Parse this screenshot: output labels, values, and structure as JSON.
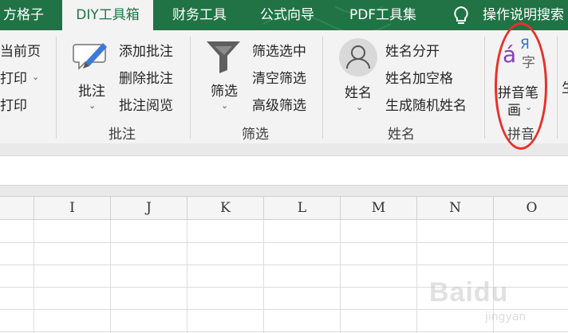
{
  "tabs": [
    "方格子",
    "DIY工具箱",
    "财务工具",
    "公式向导",
    "PDF工具集"
  ],
  "active_tab": "DIY工具箱",
  "help_search": "操作说明搜索",
  "partial_group": {
    "items": [
      "当前页",
      "打印",
      "打印"
    ]
  },
  "comment_group": {
    "big_button": "批注",
    "items": [
      "添加批注",
      "删除批注",
      "批注阅览"
    ],
    "label": "批注"
  },
  "filter_group": {
    "big_button": "筛选",
    "items": [
      "筛选选中",
      "清空筛选",
      "高级筛选"
    ],
    "label": "筛选"
  },
  "name_group": {
    "big_button": "姓名",
    "items": [
      "姓名分开",
      "姓名加空格",
      "生成随机姓名"
    ],
    "label": "姓名"
  },
  "pinyin_group": {
    "big_button_line1": "拼音笔",
    "big_button_line2": "画",
    "icon_glyph_a": "á",
    "icon_glyph_ya": "Я",
    "icon_glyph_zi": "字",
    "label": "拼音"
  },
  "next_group_partial": "生",
  "columns": [
    "I",
    "J",
    "K",
    "L",
    "M",
    "N",
    "O"
  ],
  "watermark": {
    "main": "Baidu",
    "sub": "jingyan"
  },
  "colors": {
    "tabbar": "#217346",
    "ribbon": "#f3f3f3",
    "highlight": "#e8302a",
    "pinyin_a": "#8a3fb8",
    "pinyin_ya": "#2f6fd0"
  }
}
